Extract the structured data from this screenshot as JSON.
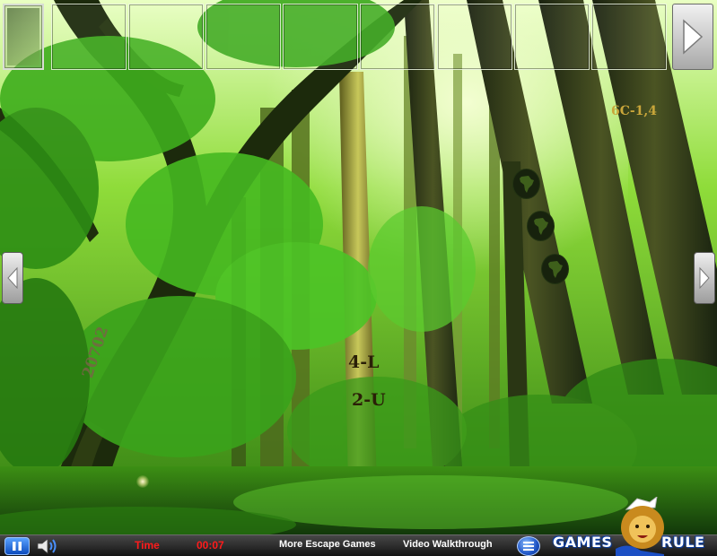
{
  "inventory": {
    "slots": [
      "",
      "",
      "",
      "",
      "",
      "",
      "",
      "",
      ""
    ],
    "next_icon": "triangle-right-icon"
  },
  "navigation": {
    "left_icon": "triangle-left-icon",
    "right_icon": "triangle-right-icon"
  },
  "clues": {
    "tree_code": "6C-1,4",
    "trunk_text_1": "4-L",
    "trunk_text_2": "2-U",
    "bark_number": "20702"
  },
  "map_tokens": [
    "africa-map-icon",
    "africa-map-icon",
    "africa-map-icon"
  ],
  "status_bar": {
    "pause_icon": "pause-icon",
    "sound_icon": "speaker-icon",
    "time_label": "Time",
    "time_value": "00:07",
    "more_games": "More Escape Games",
    "video_walkthrough": "Video Walkthrough",
    "menu_icon": "menu-icon"
  },
  "brand": {
    "word1": "GAMES",
    "word2": "RULE",
    "logo_icon": "lion-icon"
  },
  "colors": {
    "clue_gold": "#c9a63a",
    "clue_dark": "#2a1f07",
    "time_red": "#ff1b1b",
    "brand_blue": "#0a3c9e"
  }
}
